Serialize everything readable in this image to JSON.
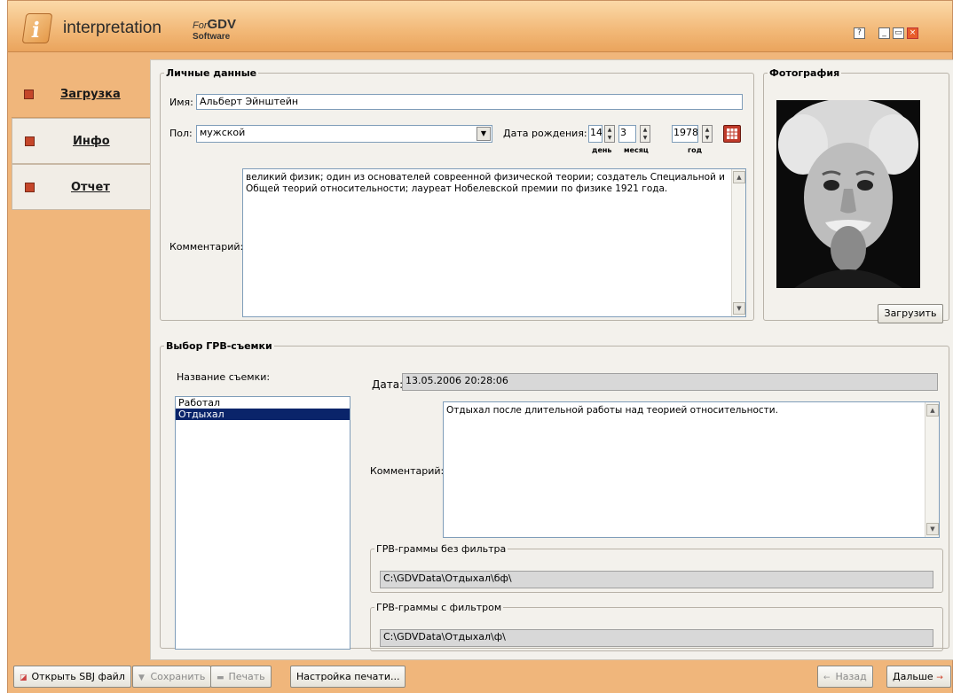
{
  "app": {
    "name": "interpretation",
    "for": "For",
    "gdv": "GDV",
    "software": "Software"
  },
  "window_buttons": {
    "help": "?",
    "minimize": "_",
    "maximize": "▭",
    "close": "×"
  },
  "sidebar": {
    "items": [
      {
        "label": "Загрузка"
      },
      {
        "label": "Инфо"
      },
      {
        "label": "Отчет"
      }
    ]
  },
  "personal": {
    "legend": "Личные данные",
    "name_label": "Имя:",
    "name_value": "Альберт Эйнштейн",
    "gender_label": "Пол:",
    "gender_value": "мужской",
    "birth_label": "Дата рождения:",
    "day": "14",
    "month": "3",
    "year": "1978",
    "day_caption": "день",
    "month_caption": "месяц",
    "year_caption": "год",
    "comment_label": "Комментарий:",
    "comment_value": "великий физик; один из основателей совреенной физической теории; создатель Специальной и Общей теорий относительности; лауреат Нобелевской премии по физике 1921 года."
  },
  "photo": {
    "legend": "Фотография",
    "load_button": "Загрузить"
  },
  "session": {
    "legend": "Выбор ГРВ-съемки",
    "name_label": "Название съемки:",
    "items": [
      {
        "label": "Работал"
      },
      {
        "label": "Отдыхал"
      }
    ],
    "date_label": "Дата:",
    "date_value": "13.05.2006 20:28:06",
    "comment_label": "Комментарий:",
    "comment_value": "Отдыхал после длительной работы над теорией относительности.",
    "nofilter_legend": "ГРВ-граммы без фильтра",
    "nofilter_path": "C:\\GDVData\\Отдыхал\\бф\\",
    "filter_legend": "ГРВ-граммы с фильтром",
    "filter_path": "C:\\GDVData\\Отдыхал\\ф\\"
  },
  "bottom": {
    "open": "Открыть SBJ файл",
    "save": "Сохранить",
    "print": "Печать",
    "print_setup": "Настройка печати...",
    "back": "Назад",
    "next": "Дальше"
  }
}
